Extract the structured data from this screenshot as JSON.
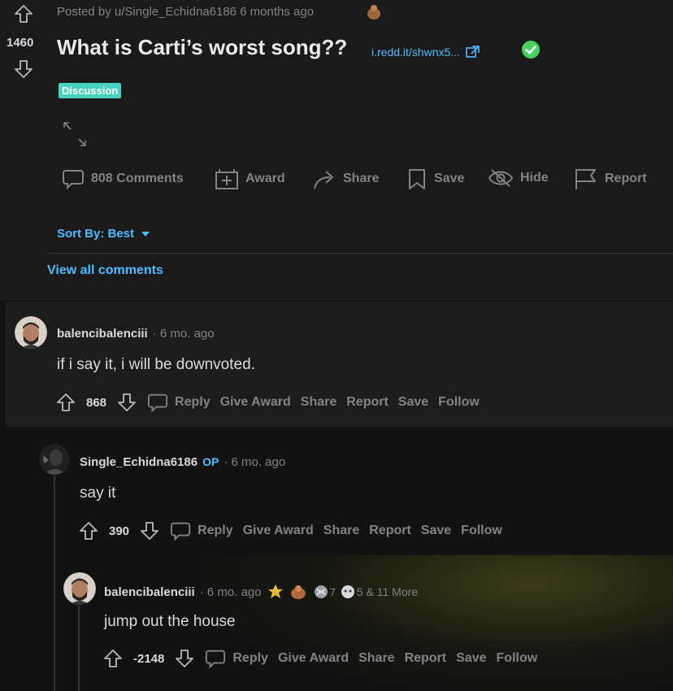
{
  "post": {
    "posted_by": "Posted by u/Single_Echidna6186 6 months ago",
    "score": "1460",
    "title": "What is Carti’s worst song??",
    "link": "i.redd.it/shwnx5...",
    "flair": "Discussion",
    "actions": {
      "comments": "808 Comments",
      "award": "Award",
      "share": "Share",
      "save": "Save",
      "hide": "Hide",
      "report": "Report"
    },
    "sort_by": "Sort By: Best",
    "view_all": "View all comments"
  },
  "comments": [
    {
      "username": "balencibalenciii",
      "time": "· 6 mo. ago",
      "text": "if i say it, i will be downvoted.",
      "score": "868"
    },
    {
      "username": "Single_Echidna6186",
      "op": "OP",
      "time": "· 6 mo. ago",
      "text": "say it",
      "score": "390"
    },
    {
      "username": "balencibalenciii",
      "time": "· 6 mo. ago",
      "award_count": "7",
      "more_awards": "5 & 11 More",
      "text": "jump out the house",
      "score": "-2148"
    }
  ],
  "comment_actions": {
    "reply": "Reply",
    "give_award": "Give Award",
    "share": "Share",
    "report": "Report",
    "save": "Save",
    "follow": "Follow"
  },
  "colors": {
    "background": "#121212",
    "accent_blue": "#4fbcff",
    "flair_teal": "#46d1c0",
    "verified_green": "#46d160"
  }
}
